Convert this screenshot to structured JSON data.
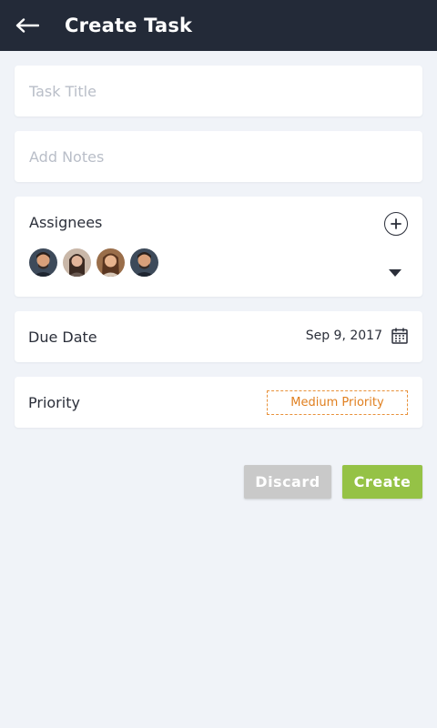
{
  "header": {
    "title": "Create Task",
    "back_icon": "arrow-left-icon",
    "background": "#232a38"
  },
  "form": {
    "task_title_placeholder": "Task Title",
    "task_title_value": "",
    "notes_placeholder": "Add Notes",
    "notes_value": "",
    "assignees": {
      "label": "Assignees",
      "add_icon": "plus-circle-icon",
      "dropdown_icon": "caret-down-icon",
      "avatars": [
        "avatar-1",
        "avatar-2",
        "avatar-3",
        "avatar-4"
      ]
    },
    "due_date": {
      "label": "Due Date",
      "value": "Sep 9, 2017",
      "icon": "calendar-icon"
    },
    "priority": {
      "label": "Priority",
      "value": "Medium Priority",
      "color": "#e07f1f"
    }
  },
  "actions": {
    "discard_label": "Discard",
    "create_label": "Create",
    "discard_color": "#c9c9c9",
    "create_color": "#95c246"
  }
}
